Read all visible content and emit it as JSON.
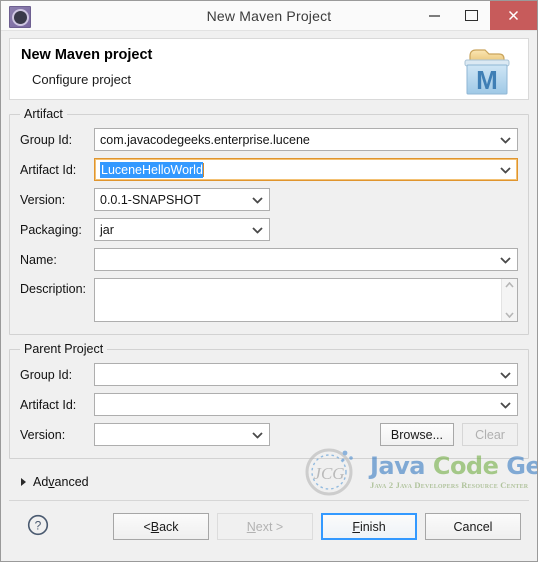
{
  "window": {
    "title": "New Maven Project",
    "app_icon": "eclipse-icon",
    "minimize_label": "Minimize",
    "maximize_label": "Maximize",
    "close_label": "Close"
  },
  "header": {
    "title": "New Maven project",
    "subtitle": "Configure project",
    "icon": "maven-project-icon",
    "icon_letter": "M"
  },
  "artifact": {
    "legend": "Artifact",
    "group_id": {
      "label": "Group Id:",
      "value": "com.javacodegeeks.enterprise.lucene"
    },
    "artifact_id": {
      "label": "Artifact Id:",
      "value": "LuceneHelloWorld",
      "selected": true,
      "focused": true
    },
    "version": {
      "label": "Version:",
      "value": "0.0.1-SNAPSHOT"
    },
    "packaging": {
      "label": "Packaging:",
      "value": "jar"
    },
    "name": {
      "label": "Name:",
      "value": ""
    },
    "description": {
      "label": "Description:",
      "value": ""
    }
  },
  "parent_project": {
    "legend": "Parent Project",
    "group_id": {
      "label": "Group Id:",
      "value": ""
    },
    "artifact_id": {
      "label": "Artifact Id:",
      "value": ""
    },
    "version": {
      "label": "Version:",
      "value": ""
    },
    "browse_label": "Browse...",
    "clear_label": "Clear",
    "clear_enabled": false
  },
  "advanced": {
    "label": "Advanced",
    "mnemonic": "v",
    "expanded": false
  },
  "watermark": {
    "mark": "JCG",
    "word1": "Java",
    "word2": "Code",
    "word3": "Geeks",
    "tagline": "Java 2 Java Developers Resource Center"
  },
  "footer": {
    "help_label": "?",
    "back_label": "< Back",
    "back_mnemonic": "B",
    "next_label": "Next >",
    "next_mnemonic": "N",
    "next_enabled": false,
    "finish_label": "Finish",
    "finish_mnemonic": "F",
    "finish_default": true,
    "cancel_label": "Cancel"
  },
  "colors": {
    "selection_blue": "#3399ff",
    "focus_orange": "#e0952e",
    "close_red": "#c75b5b",
    "logo_blue": "#3c7ec4",
    "logo_green": "#77b04a"
  }
}
